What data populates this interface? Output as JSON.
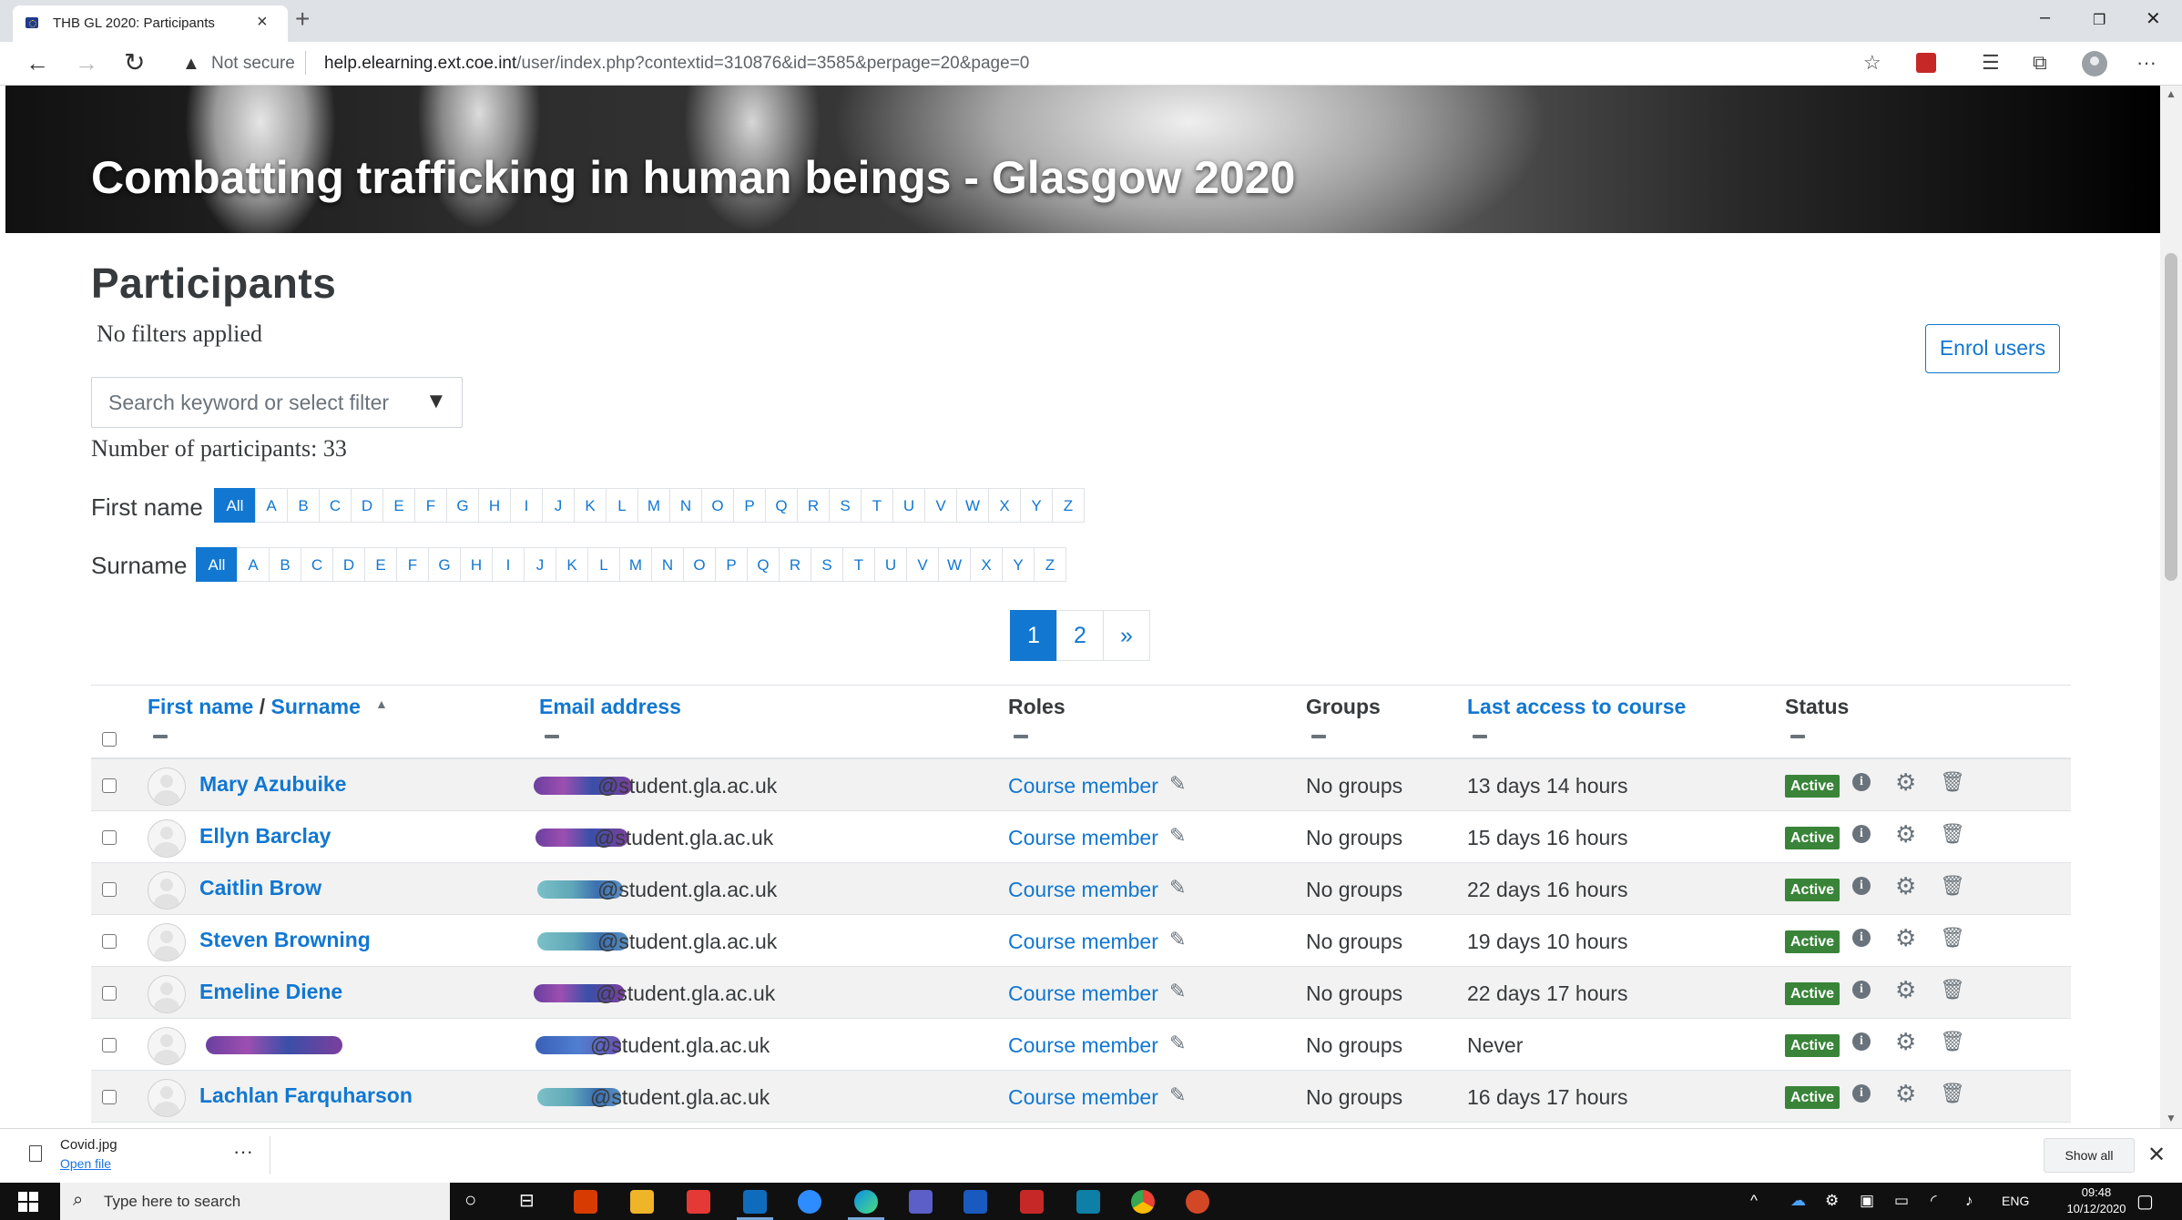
{
  "browser": {
    "tab_title": "THB GL 2020: Participants",
    "not_secure": "Not secure",
    "url_host": "help.elearning.ext.coe.int",
    "url_path": "/user/index.php?contextid=310876&id=3585&perpage=20&page=0"
  },
  "course": {
    "title": "Combatting trafficking in human beings - Glasgow 2020"
  },
  "page": {
    "heading": "Participants",
    "filters_status": "No filters applied",
    "enrol_button": "Enrol users",
    "search_placeholder": "Search keyword or select filter",
    "participant_count": "Number of participants: 33"
  },
  "initials": {
    "first_name_label": "First name",
    "surname_label": "Surname",
    "all_label": "All",
    "letters": [
      "A",
      "B",
      "C",
      "D",
      "E",
      "F",
      "G",
      "H",
      "I",
      "J",
      "K",
      "L",
      "M",
      "N",
      "O",
      "P",
      "Q",
      "R",
      "S",
      "T",
      "U",
      "V",
      "W",
      "X",
      "Y",
      "Z"
    ]
  },
  "pagination": {
    "pages": [
      "1",
      "2"
    ],
    "current": "1",
    "next": "»"
  },
  "table": {
    "headers": {
      "first_name": "First name",
      "sep": " / ",
      "surname": "Surname",
      "email": "Email address",
      "roles": "Roles",
      "groups": "Groups",
      "last_access": "Last access to course",
      "status": "Status"
    },
    "rows": [
      {
        "name": "Mary Azubuike",
        "email": "@student.gla.ac.uk",
        "role": "Course member",
        "groups": "No groups",
        "last_access": "13 days 14 hours",
        "status": "Active"
      },
      {
        "name": "Ellyn Barclay",
        "email": "@student.gla.ac.uk",
        "role": "Course member",
        "groups": "No groups",
        "last_access": "15 days 16 hours",
        "status": "Active"
      },
      {
        "name": "Caitlin Brow",
        "email": "@student.gla.ac.uk",
        "role": "Course member",
        "groups": "No groups",
        "last_access": "22 days 16 hours",
        "status": "Active"
      },
      {
        "name": "Steven Browning",
        "email": "@student.gla.ac.uk",
        "role": "Course member",
        "groups": "No groups",
        "last_access": "19 days 10 hours",
        "status": "Active"
      },
      {
        "name": "Emeline Diene",
        "email": "@student.gla.ac.uk",
        "role": "Course member",
        "groups": "No groups",
        "last_access": "22 days 17 hours",
        "status": "Active"
      },
      {
        "name": "",
        "email": "@student.gla.ac.uk",
        "role": "Course member",
        "groups": "No groups",
        "last_access": "Never",
        "status": "Active"
      },
      {
        "name": "Lachlan Farquharson",
        "email": "@student.gla.ac.uk",
        "role": "Course member",
        "groups": "No groups",
        "last_access": "16 days 17 hours",
        "status": "Active"
      }
    ]
  },
  "downloads": {
    "file_name": "Covid.jpg",
    "open_file": "Open file",
    "show_all": "Show all"
  },
  "taskbar": {
    "search_placeholder": "Type here to search",
    "language": "ENG",
    "time": "09:48",
    "date": "10/12/2020"
  },
  "colors": {
    "brand_blue": "#1177d1",
    "active_badge": "#398439",
    "text": "#373a3c"
  },
  "icons": [
    "back-arrow-icon",
    "forward-arrow-icon",
    "refresh-icon",
    "warning-icon",
    "star-icon",
    "favorites-icon",
    "collections-icon",
    "profile-icon",
    "more-icon",
    "info-icon",
    "gear-icon",
    "trash-icon",
    "pencil-icon",
    "sort-up-icon",
    "caret-down-icon"
  ]
}
